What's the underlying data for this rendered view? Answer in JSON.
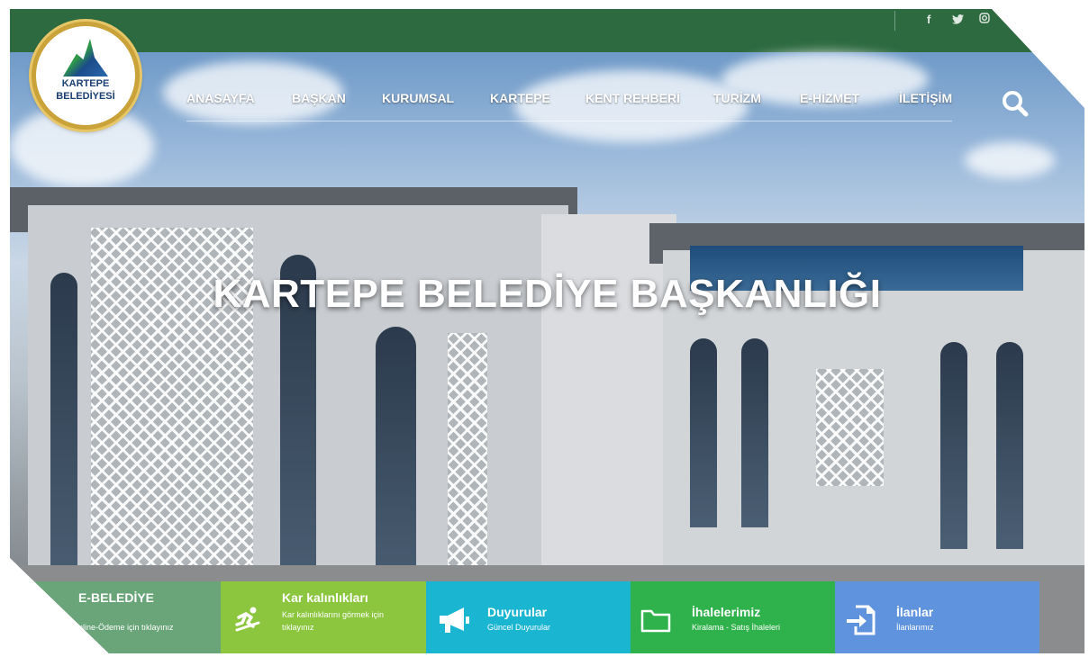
{
  "social": {
    "facebook_icon": "f",
    "twitter_icon": "t",
    "instagram_icon": "instagram-icon"
  },
  "logo": {
    "line1": "KARTEPE",
    "line2": "BELEDİYESİ"
  },
  "nav": {
    "items": [
      "ANASAYFA",
      "BAŞKAN",
      "KURUMSAL",
      "KARTEPE",
      "KENT REHBERİ",
      "TURİZM",
      "E-HİZMET",
      "İLETİŞİM"
    ]
  },
  "hero": {
    "headline": "KARTEPE BELEDİYE BAŞKANLIĞI"
  },
  "tiles": [
    {
      "title": "E-BELEDİYE",
      "subtitle": "nline-Ödeme için tıklayınız",
      "color": "#6aa57a",
      "icon": "e-belediye-icon"
    },
    {
      "title": "Kar kalınlıkları",
      "subtitle": "Kar kalınlıklarını görmek için tıklayınız",
      "color": "#8cc63f",
      "icon": "skier-icon"
    },
    {
      "title": "Duyurular",
      "subtitle": "Güncel Duyurular",
      "color": "#1ab5d1",
      "icon": "megaphone-icon"
    },
    {
      "title": "İhalelerimiz",
      "subtitle": "Kiralama - Satış İhaleleri",
      "color": "#2fb24b",
      "icon": "folder-icon"
    },
    {
      "title": "İlanlar",
      "subtitle": "İlanlarımız",
      "color": "#5f93de",
      "icon": "sign-in-icon"
    }
  ],
  "colors": {
    "topbar": "#2d6a40",
    "logo_ring": "#c9a23a"
  }
}
